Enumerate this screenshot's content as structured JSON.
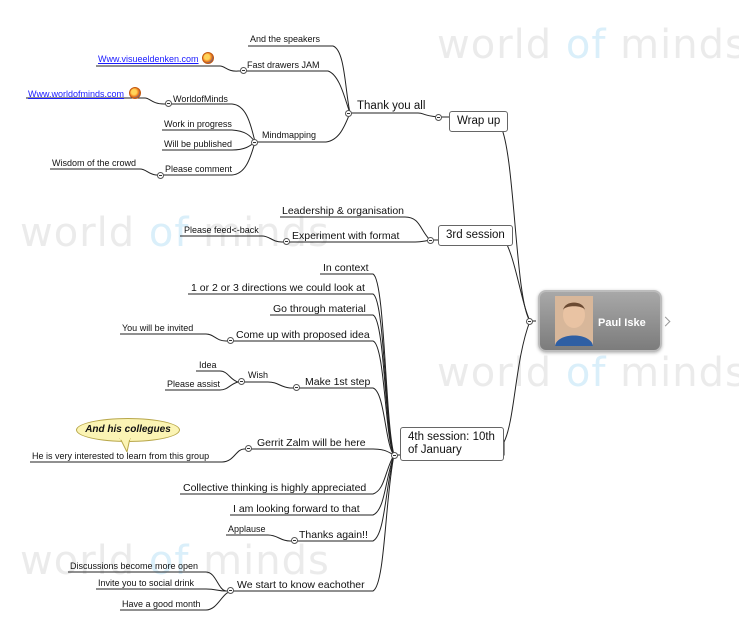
{
  "watermark": {
    "part1": "world",
    "part2": "of",
    "part3": "minds"
  },
  "central": {
    "name": "Paul Iske"
  },
  "wrapup": {
    "label": "Wrap up",
    "thanks": {
      "label": "Thank you all",
      "speakers": "And the speakers",
      "fastdrawers": {
        "label": "Fast drawers JAM",
        "link": "Www.visueeldenken.com"
      },
      "mindmapping": {
        "label": "Mindmapping",
        "worldofminds": {
          "label": "WorldofMinds",
          "link": "Www.worldofminds.com"
        },
        "progress": "Work in progress",
        "published": "Will be published",
        "comment": {
          "label": "Please comment",
          "wisdom": "Wisdom of the crowd"
        }
      }
    }
  },
  "session3": {
    "label": "3rd session",
    "leadership": "Leadership & organisation",
    "experiment": {
      "label": "Experiment with format",
      "feedback": "Please feed<-back"
    }
  },
  "session4": {
    "label_line1": "4th session: 10th",
    "label_line2": "of January",
    "context": "In context",
    "directions": "1 or 2 or 3 directions we could look at",
    "material": "Go through material",
    "proposed": {
      "label": "Come up with proposed idea",
      "invited": "You will be invited"
    },
    "firststep": {
      "label": "Make 1st step",
      "wish": {
        "label": "Wish",
        "idea": "Idea",
        "assist": "Please assist"
      }
    },
    "zalm": {
      "label": "Gerrit Zalm will be here",
      "interested": "He is very interested to learn from this group",
      "callout": "And his collegues"
    },
    "collective": "Collective thinking is highly appreciated",
    "forward": "I am looking forward to that",
    "thanks": {
      "label": "Thanks again!!",
      "applause": "Applause"
    },
    "know": {
      "label": "We start to know eachother",
      "open": "Discussions become more open",
      "drink": "Invite you to social drink",
      "month": "Have a good month"
    }
  }
}
